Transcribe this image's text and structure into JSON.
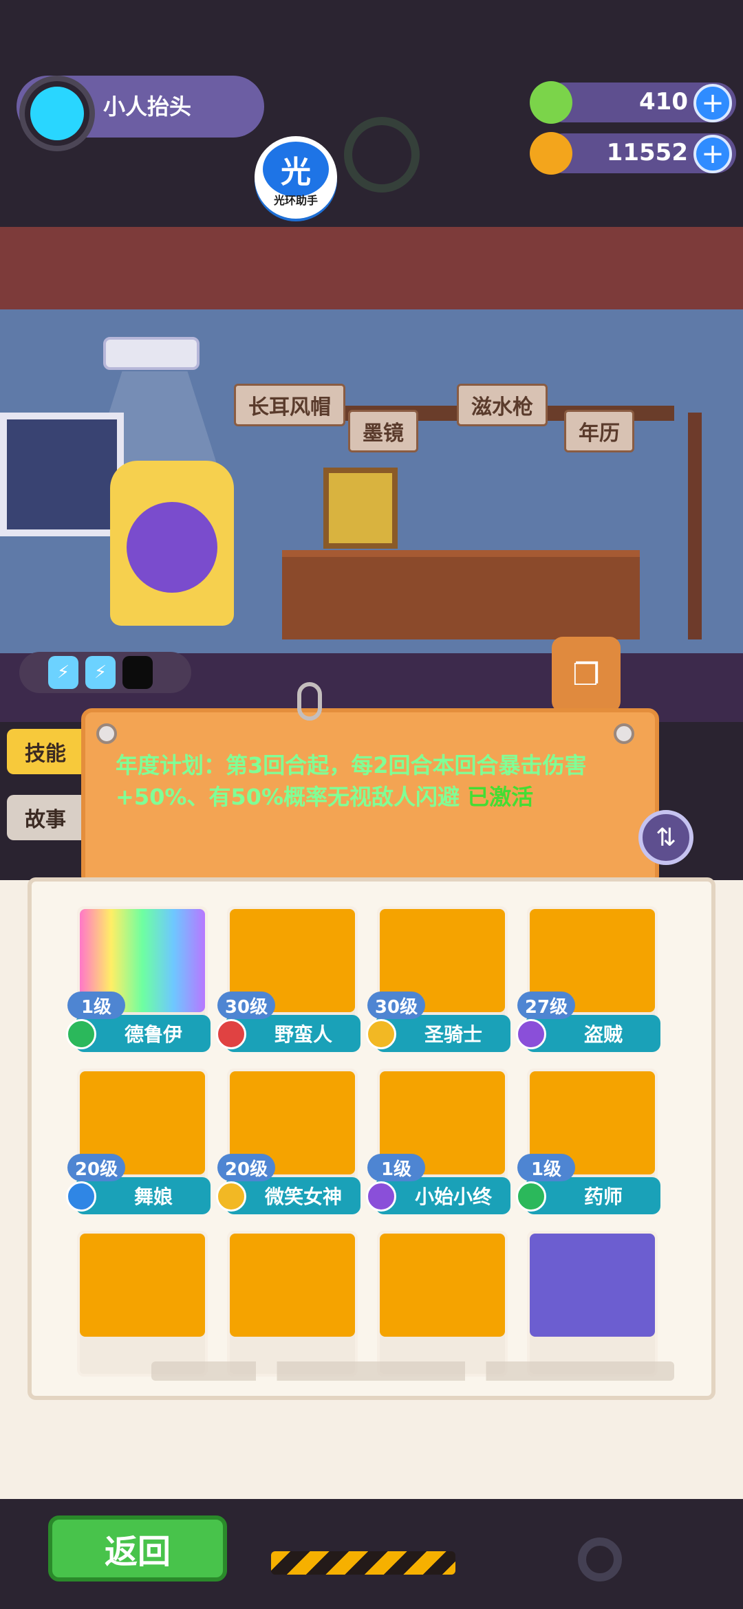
{
  "player": {
    "name": "小人抬头"
  },
  "helper": {
    "glyph": "光",
    "label": "光环助手"
  },
  "currency": [
    {
      "value": "410",
      "icon": "green-gem-icon",
      "color": "#7bd44a"
    },
    {
      "value": "11552",
      "icon": "gold-planet-icon",
      "color": "#f3a51c"
    }
  ],
  "room": {
    "shelf_items": [
      {
        "label": "长耳风帽"
      },
      {
        "label": "墨镜"
      },
      {
        "label": "滋水枪"
      },
      {
        "label": "年历"
      }
    ]
  },
  "charges": [
    "⚡",
    "⚡",
    ""
  ],
  "side_tabs": [
    {
      "label": "技能",
      "active": true
    },
    {
      "label": "故事",
      "active": false
    }
  ],
  "skill": {
    "text": "年度计划：第3回合起，每2回合本回合暴击伤害+50%、有50%概率无视敌人闪避",
    "status": "已激活"
  },
  "heroes": [
    {
      "name": "德鲁伊",
      "level": "1级",
      "class_color": "#2bb85b",
      "art": "rainbow"
    },
    {
      "name": "野蛮人",
      "level": "30级",
      "class_color": "#e04242",
      "art": "gold"
    },
    {
      "name": "圣骑士",
      "level": "30级",
      "class_color": "#f2b824",
      "art": "gold"
    },
    {
      "name": "盗贼",
      "level": "27级",
      "class_color": "#8a4fd9",
      "art": "gold"
    },
    {
      "name": "舞娘",
      "level": "20级",
      "class_color": "#2f86e5",
      "art": "gold"
    },
    {
      "name": "微笑女神",
      "level": "20级",
      "class_color": "#f2b824",
      "art": "gold"
    },
    {
      "name": "小始小终",
      "level": "1级",
      "class_color": "#8a4fd9",
      "art": "gold"
    },
    {
      "name": "药师",
      "level": "1级",
      "class_color": "#2bb85b",
      "art": "gold"
    },
    {
      "name": "",
      "level": "",
      "class_color": "#2bb85b",
      "art": "gold"
    },
    {
      "name": "",
      "level": "",
      "class_color": "#2bb85b",
      "art": "gold"
    },
    {
      "name": "",
      "level": "",
      "class_color": "#2bb85b",
      "art": "gold"
    },
    {
      "name": "",
      "level": "",
      "class_color": "#2bb85b",
      "art": "purple"
    }
  ],
  "buttons": {
    "back": "返回"
  }
}
